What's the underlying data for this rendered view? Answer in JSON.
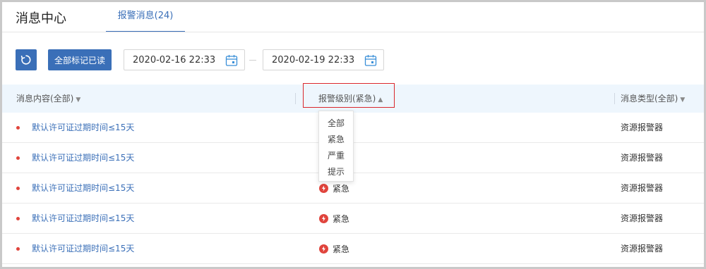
{
  "header": {
    "title": "消息中心",
    "active_tab": "报警消息(24)"
  },
  "toolbar": {
    "refresh_icon": "refresh-icon",
    "mark_all_read_label": "全部标记已读",
    "date_start": "2020-02-16 22:33",
    "date_end": "2020-02-19 22:33",
    "calendar_icon": "calendar-icon",
    "accent_color": "#3a6fb8"
  },
  "table": {
    "columns": {
      "content": "消息内容(全部)",
      "level": "报警级别(紧急)",
      "type": "消息类型(全部)"
    },
    "rows": [
      {
        "content": "默认许可证过期时间≤15天",
        "level": "",
        "type": "资源报警器"
      },
      {
        "content": "默认许可证过期时间≤15天",
        "level": "",
        "type": "资源报警器"
      },
      {
        "content": "默认许可证过期时间≤15天",
        "level": "紧急",
        "type": "资源报警器"
      },
      {
        "content": "默认许可证过期时间≤15天",
        "level": "紧急",
        "type": "资源报警器"
      },
      {
        "content": "默认许可证过期时间≤15天",
        "level": "紧急",
        "type": "资源报警器"
      }
    ],
    "urgent_color": "#e0443c"
  },
  "level_dropdown": {
    "options": [
      "全部",
      "紧急",
      "严重",
      "提示"
    ]
  }
}
